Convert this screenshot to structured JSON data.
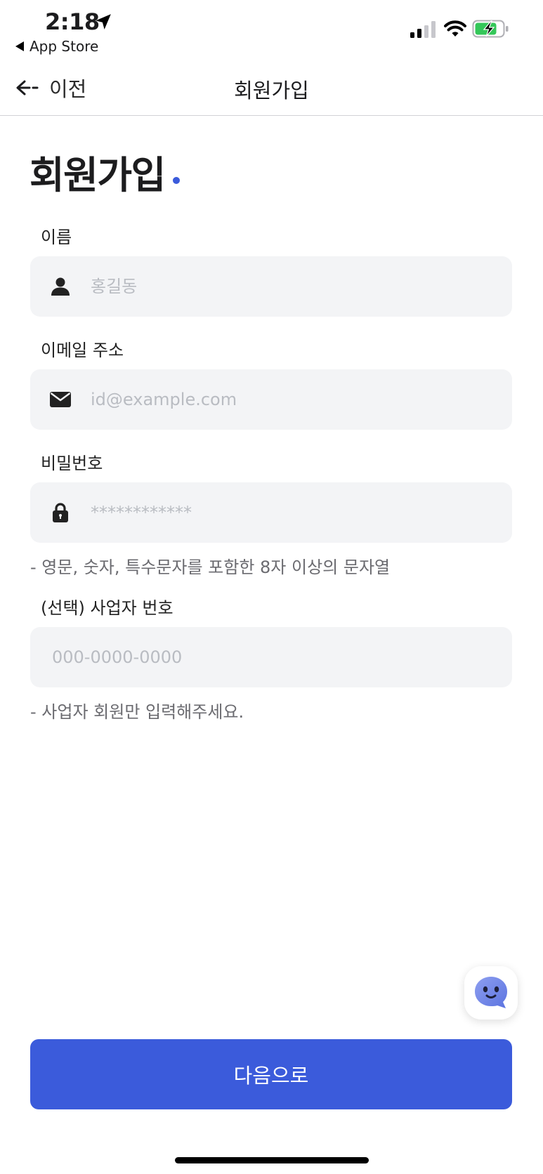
{
  "status_bar": {
    "time": "2:18",
    "back_app_label": "App Store"
  },
  "nav": {
    "back_label": "이전",
    "title": "회원가입"
  },
  "page": {
    "heading": "회원가입",
    "accent_color": "#3b5bdb"
  },
  "form": {
    "name": {
      "label": "이름",
      "placeholder": "홍길동",
      "value": "",
      "icon": "person-icon"
    },
    "email": {
      "label": "이메일 주소",
      "placeholder": "id@example.com",
      "value": "",
      "icon": "envelope-icon"
    },
    "password": {
      "label": "비밀번호",
      "placeholder": "************",
      "value": "",
      "icon": "lock-icon",
      "hint": "- 영문, 숫자, 특수문자를 포함한 8자 이상의 문자열"
    },
    "business_number": {
      "label": "(선택) 사업자 번호",
      "placeholder": "000-0000-0000",
      "value": "",
      "hint": "- 사업자 회원만 입력해주세요."
    }
  },
  "actions": {
    "next_label": "다음으로",
    "chatbot_icon": "chatbot-icon"
  }
}
